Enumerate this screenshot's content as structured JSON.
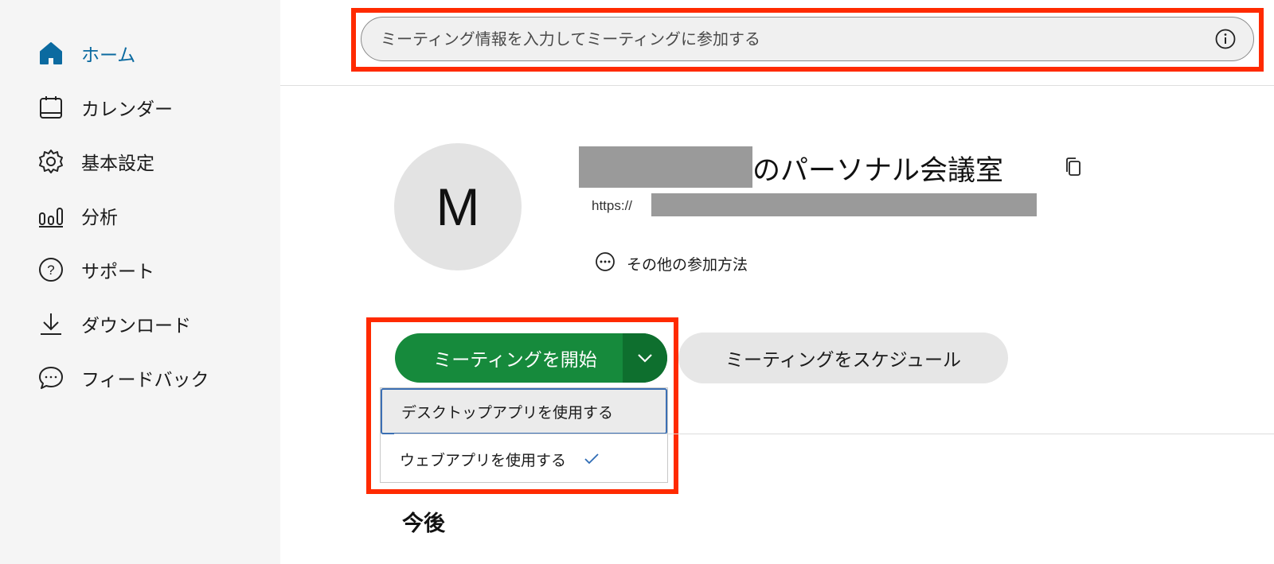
{
  "sidebar": {
    "items": [
      {
        "label": "ホーム",
        "icon": "home-icon",
        "active": true
      },
      {
        "label": "カレンダー",
        "icon": "calendar-icon"
      },
      {
        "label": "基本設定",
        "icon": "gear-icon"
      },
      {
        "label": "分析",
        "icon": "analytics-icon"
      },
      {
        "label": "サポート",
        "icon": "help-icon"
      },
      {
        "label": "ダウンロード",
        "icon": "download-icon"
      },
      {
        "label": "フィードバック",
        "icon": "feedback-icon"
      }
    ]
  },
  "search": {
    "placeholder": "ミーティング情報を入力してミーティングに参加する",
    "icon": "info-icon"
  },
  "room": {
    "avatar_letter": "M",
    "title_suffix": "のパーソナル会議室",
    "url_prefix": "https://",
    "other_methods_label": "その他の参加方法"
  },
  "actions": {
    "start_label": "ミーティングを開始",
    "schedule_label": "ミーティングをスケジュール"
  },
  "start_menu": {
    "options": [
      {
        "label": "デスクトップアプリを使用する",
        "highlighted": true
      },
      {
        "label": "ウェブアプリを使用する",
        "selected": true
      }
    ]
  },
  "upcoming": {
    "heading": "今後"
  },
  "colors": {
    "accent_blue": "#0b6aa0",
    "start_green": "#168a3c",
    "start_green_dark": "#0e6f2e",
    "annotation_red": "#ff2a00"
  }
}
